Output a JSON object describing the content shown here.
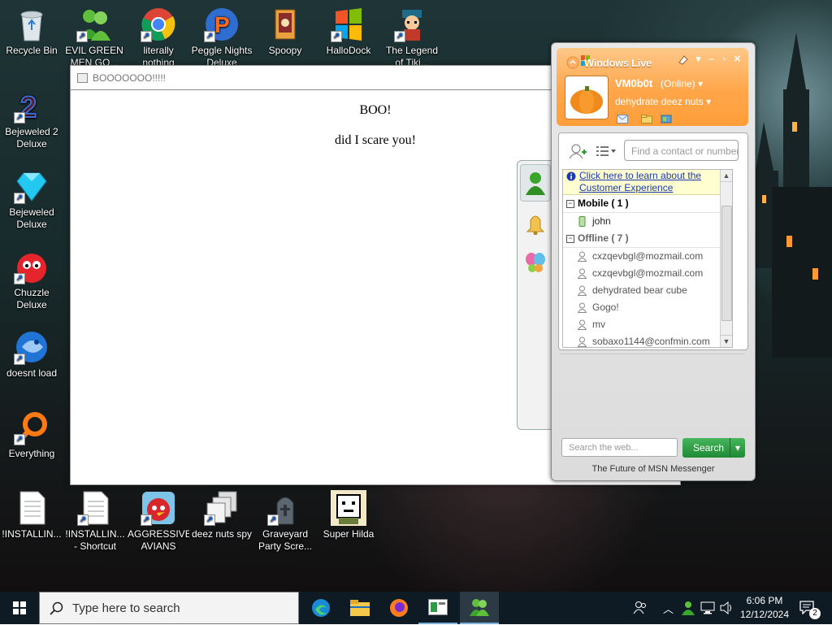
{
  "desktop_icons": [
    {
      "label": "Recycle Bin",
      "icon": "recycle-bin-icon"
    },
    {
      "label": "EVIL GREEN MEN GO...",
      "icon": "msn-buddies-icon"
    },
    {
      "label": "literally nothing",
      "icon": "chrome-icon"
    },
    {
      "label": "Peggle Nights Deluxe",
      "icon": "peggle-icon"
    },
    {
      "label": "Spoopy",
      "icon": "spoopy-icon"
    },
    {
      "label": "HalloDock",
      "icon": "windows-logo-icon"
    },
    {
      "label": "The Legend of Tiki...",
      "icon": "game-character-icon"
    },
    {
      "label": "Bejeweled 2 Deluxe",
      "icon": "bejeweled-2-icon"
    },
    {
      "label": "Bejeweled Deluxe",
      "icon": "bejeweled-gem-icon"
    },
    {
      "label": "Chuzzle Deluxe",
      "icon": "chuzzle-icon"
    },
    {
      "label": "doesnt load",
      "icon": "thunderbird-icon"
    },
    {
      "label": "Everything",
      "icon": "everything-search-icon"
    },
    {
      "label": "!INSTALLIN...",
      "icon": "text-file-icon"
    },
    {
      "label": "!INSTALLIN... - Shortcut",
      "icon": "text-file-shortcut-icon"
    },
    {
      "label": "AGGRESSIVE AVIANS",
      "icon": "angry-bird-icon"
    },
    {
      "label": "deez nuts spy",
      "icon": "file-stack-icon"
    },
    {
      "label": "Graveyard Party Scre...",
      "icon": "graveyard-icon"
    },
    {
      "label": "Super Hilda",
      "icon": "pixel-art-icon"
    }
  ],
  "browser": {
    "title": "BOOOOOOO!!!!!",
    "heading": "BOO!",
    "line": "did I scare you!"
  },
  "messenger": {
    "brand": "Windows Live",
    "username": "VM0b0t",
    "status": "(Online)",
    "personal_message": "dehydrate deez nuts",
    "find_placeholder": "Find a contact or number...",
    "notice": "Click here to learn about the Customer Experience",
    "groups": [
      {
        "name": "Mobile ( 1 )",
        "contacts": [
          "john"
        ]
      },
      {
        "name": "Offline ( 7 )",
        "contacts": [
          "cxzqevbgl@mozmail.com",
          "cxzqevbgl@mozmail.com",
          "dehydrated bear cube",
          "Gogo!",
          "mv",
          "sobaxo1144@confmin.com"
        ]
      }
    ],
    "search_placeholder": "Search the web...",
    "search_button": "Search",
    "footer": "The Future of MSN Messenger"
  },
  "taskbar": {
    "search_placeholder": "Type here to search",
    "time": "6:06 PM",
    "date": "12/12/2024",
    "notification_count": "2"
  },
  "colors": {
    "msn_orange": "#ff9e3a",
    "search_green": "#1f8a34",
    "taskbar": "#0f1b24"
  }
}
